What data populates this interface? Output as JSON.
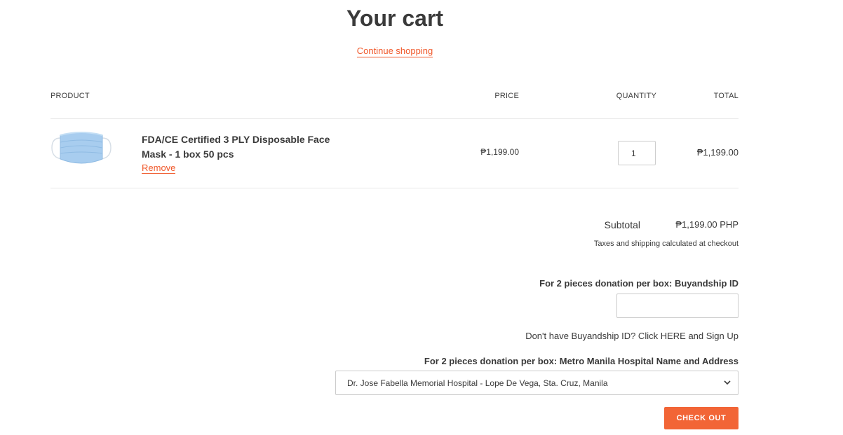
{
  "page": {
    "title": "Your cart",
    "continue_link": "Continue shopping"
  },
  "table": {
    "headers": {
      "product": "PRODUCT",
      "price": "PRICE",
      "quantity": "QUANTITY",
      "total": "TOTAL"
    },
    "items": [
      {
        "name": "FDA/CE Certified 3 PLY Disposable Face Mask - 1 box 50 pcs",
        "remove_label": "Remove",
        "price": "₱1,199.00",
        "quantity": "1",
        "total": "₱1,199.00",
        "icon": "face-mask-image"
      }
    ]
  },
  "summary": {
    "subtotal_label": "Subtotal",
    "subtotal_value": "₱1,199.00 PHP",
    "tax_note": "Taxes and shipping calculated at checkout"
  },
  "donation": {
    "buyandship_label": "For 2 pieces donation per box: Buyandship ID",
    "buyandship_value": "",
    "signup_text": "Don't have Buyandship ID? Click HERE and Sign Up",
    "hospital_label": "For 2 pieces donation per box: Metro Manila Hospital Name and Address",
    "hospital_selected": "Dr. Jose Fabella Memorial Hospital - Lope De Vega, Sta. Cruz, Manila"
  },
  "actions": {
    "checkout_label": "CHECK OUT"
  },
  "colors": {
    "accent": "#f0582a",
    "checkout_bg": "#f26536",
    "text": "#3a3a3a",
    "divider": "#e8e8e8",
    "mask_blue": "#a8cdef"
  }
}
